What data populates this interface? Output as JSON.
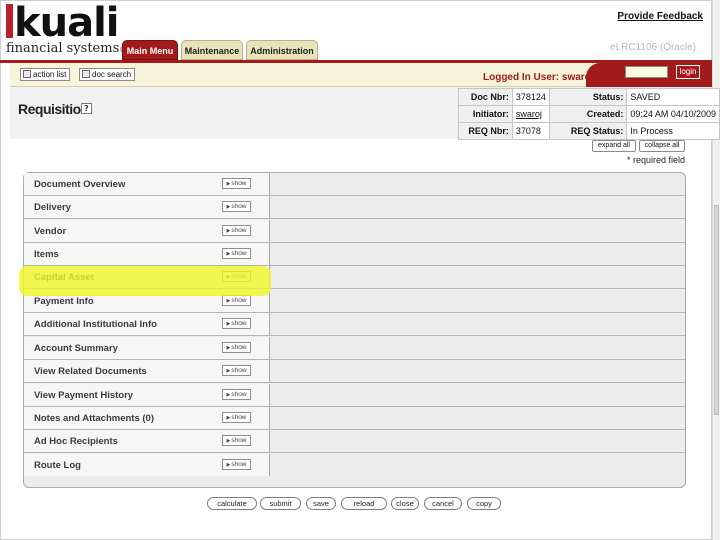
{
  "header": {
    "logo_text": "kuali",
    "logo_subtitle": "financial systems",
    "logo_mark": "®",
    "provide_feedback": "Provide Feedback",
    "server_label": "eLRC1106 (Oracle)"
  },
  "tabs": [
    {
      "label": "Main Menu",
      "active": true
    },
    {
      "label": "Maintenance",
      "active": false
    },
    {
      "label": "Administration",
      "active": false
    }
  ],
  "toolbar": {
    "action_list": "action list",
    "doc_search": "doc search",
    "logged_in": "Logged In User: swaroj",
    "login_input_value": "",
    "login_button": "login"
  },
  "document": {
    "title": "Requisition",
    "help_icon": "?",
    "doc_nbr_label": "Doc Nbr:",
    "doc_nbr": "378124",
    "status_label": "Status:",
    "status": "SAVED",
    "initiator_label": "Initiator:",
    "initiator": "swaroj",
    "created_label": "Created:",
    "created": "09:24 AM 04/10/2009",
    "req_nbr_label": "REQ Nbr:",
    "req_nbr": "37078",
    "req_status_label": "REQ Status:",
    "req_status": "In Process",
    "expand_all": "expand all",
    "collapse_all": "collapse all",
    "required_note": "* required field"
  },
  "sections": [
    {
      "label": "Document Overview",
      "show": "show"
    },
    {
      "label": "Delivery",
      "show": "show"
    },
    {
      "label": "Vendor",
      "show": "show"
    },
    {
      "label": "Items",
      "show": "show"
    },
    {
      "label": "Capital Asset",
      "show": "show"
    },
    {
      "label": "Payment Info",
      "show": "show"
    },
    {
      "label": "Additional Institutional Info",
      "show": "show"
    },
    {
      "label": "Account Summary",
      "show": "show"
    },
    {
      "label": "View Related Documents",
      "show": "show"
    },
    {
      "label": "View Payment History",
      "show": "show"
    },
    {
      "label": "Notes and Attachments (0)",
      "show": "show"
    },
    {
      "label": "Ad Hoc Recipients",
      "show": "show"
    },
    {
      "label": "Route Log",
      "show": "show"
    }
  ],
  "buttons": [
    "calculate",
    "submit",
    "save",
    "reload",
    "close",
    "cancel",
    "copy"
  ],
  "colors": {
    "brand_red": "#a31a1a",
    "tab_inactive": "#e9e3b9",
    "highlight": "#eef528"
  }
}
